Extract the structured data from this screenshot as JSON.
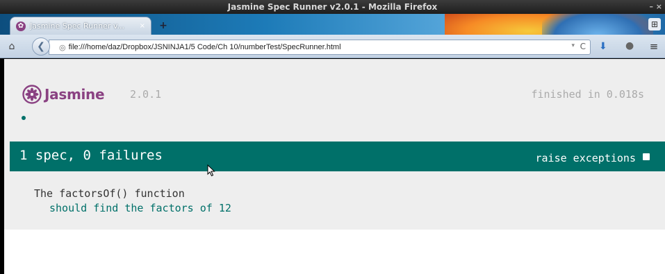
{
  "window": {
    "title": "Jasmine Spec Runner v2.0.1 - Mozilla Firefox",
    "controls": "– ×"
  },
  "tabs": [
    {
      "label": "Jasmine Spec Runner v...",
      "icon": "jasmine-favicon-icon",
      "close": "×"
    }
  ],
  "new_tab": "+",
  "navbar": {
    "url": "file:///home/daz/Dropbox/JSNINJA1/5 Code/Ch 10/numberTest/SpecRunner.html",
    "reload": "C"
  },
  "jasmine": {
    "logo_text": "Jasmine",
    "version": "2.0.1",
    "duration": "finished in 0.018s",
    "summary": "1 spec, 0 failures",
    "raise_exceptions_label": "raise exceptions",
    "raise_exceptions_checked": false,
    "suites": [
      {
        "description": "The factorsOf() function",
        "specs": [
          {
            "description": "should find the factors of 12",
            "status": "passed"
          }
        ]
      }
    ]
  },
  "colors": {
    "jasmine_purple": "#8a4182",
    "passed_green": "#007069",
    "background": "#eeeeee"
  }
}
